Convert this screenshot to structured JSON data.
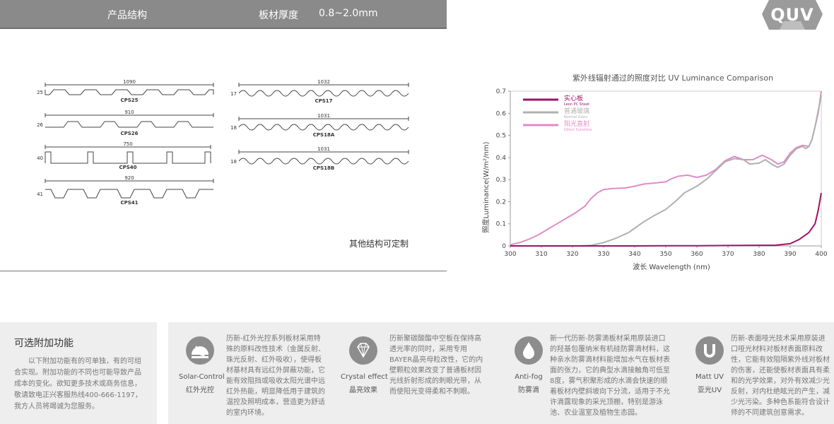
{
  "header": {
    "title": "产品结构",
    "thickness_label": "板材厚度",
    "thickness_value": "0.8~2.0mm"
  },
  "logo": {
    "text": "QUV"
  },
  "profiles": [
    {
      "name": "CPS25",
      "width": "1090",
      "height": "25"
    },
    {
      "name": "CPS26",
      "width": "910",
      "height": "26"
    },
    {
      "name": "CPS40",
      "width": "750",
      "height": "40"
    },
    {
      "name": "CPS41",
      "width": "920",
      "height": "41"
    },
    {
      "name": "CPS17",
      "width": "1032",
      "height": "17"
    },
    {
      "name": "CPS18A",
      "width": "1031",
      "height": "18"
    },
    {
      "name": "CPS18B",
      "width": "1031",
      "height": "18"
    }
  ],
  "custom_note": "其他结构可定制",
  "chart_data": {
    "type": "line",
    "title": "紫外线辐射通过的照度对比 UV Luminance Comparison",
    "xlabel": "波长 Wavelength (nm)",
    "ylabel": "照度Luminance(W/m²/nm)",
    "xlim": [
      300,
      400
    ],
    "ylim": [
      0,
      0.7
    ],
    "x_ticks": [
      "300",
      "310",
      "320",
      "330",
      "340",
      "350",
      "360",
      "370",
      "380",
      "390",
      "400"
    ],
    "y_ticks": [
      "0",
      "0.1",
      "0.2",
      "0.3",
      "0.4",
      "0.5",
      "0.6",
      "0.7"
    ],
    "legend_position": "top-left",
    "series": [
      {
        "name": "实心板",
        "name_en": "Leon PC Sheet",
        "color": "#a0106a",
        "points": [
          [
            300,
            0
          ],
          [
            340,
            0
          ],
          [
            350,
            0.001
          ],
          [
            360,
            0.001
          ],
          [
            370,
            0.002
          ],
          [
            380,
            0.003
          ],
          [
            385,
            0.003
          ],
          [
            390,
            0.01
          ],
          [
            393,
            0.03
          ],
          [
            396,
            0.06
          ],
          [
            398,
            0.1
          ],
          [
            399,
            0.16
          ],
          [
            400,
            0.24
          ]
        ]
      },
      {
        "name": "普通玻璃",
        "name_en": "Normal Glass",
        "color": "#b0b0b0",
        "points": [
          [
            300,
            0
          ],
          [
            322,
            0
          ],
          [
            326,
            0.003
          ],
          [
            330,
            0.015
          ],
          [
            334,
            0.035
          ],
          [
            338,
            0.06
          ],
          [
            340,
            0.08
          ],
          [
            343,
            0.11
          ],
          [
            346,
            0.135
          ],
          [
            350,
            0.165
          ],
          [
            353,
            0.2
          ],
          [
            356,
            0.24
          ],
          [
            360,
            0.27
          ],
          [
            363,
            0.3
          ],
          [
            366,
            0.34
          ],
          [
            369,
            0.38
          ],
          [
            372,
            0.395
          ],
          [
            375,
            0.39
          ],
          [
            377,
            0.37
          ],
          [
            380,
            0.375
          ],
          [
            382,
            0.39
          ],
          [
            384,
            0.37
          ],
          [
            386,
            0.355
          ],
          [
            388,
            0.37
          ],
          [
            390,
            0.41
          ],
          [
            392,
            0.44
          ],
          [
            394,
            0.45
          ],
          [
            395,
            0.44
          ],
          [
            396,
            0.45
          ],
          [
            397,
            0.48
          ],
          [
            398,
            0.54
          ],
          [
            399,
            0.61
          ],
          [
            400,
            0.68
          ]
        ]
      },
      {
        "name": "阳光直射",
        "name_en": "Direct Sunshine",
        "color": "#e08cc8",
        "points": [
          [
            300,
            0.005
          ],
          [
            303,
            0.015
          ],
          [
            306,
            0.03
          ],
          [
            309,
            0.05
          ],
          [
            312,
            0.075
          ],
          [
            315,
            0.1
          ],
          [
            318,
            0.125
          ],
          [
            321,
            0.15
          ],
          [
            324,
            0.18
          ],
          [
            326,
            0.215
          ],
          [
            328,
            0.24
          ],
          [
            330,
            0.255
          ],
          [
            333,
            0.26
          ],
          [
            337,
            0.262
          ],
          [
            340,
            0.27
          ],
          [
            343,
            0.28
          ],
          [
            347,
            0.285
          ],
          [
            350,
            0.29
          ],
          [
            352,
            0.305
          ],
          [
            354,
            0.315
          ],
          [
            357,
            0.32
          ],
          [
            360,
            0.31
          ],
          [
            363,
            0.32
          ],
          [
            366,
            0.345
          ],
          [
            369,
            0.385
          ],
          [
            372,
            0.405
          ],
          [
            375,
            0.39
          ],
          [
            378,
            0.39
          ],
          [
            381,
            0.41
          ],
          [
            384,
            0.39
          ],
          [
            386,
            0.37
          ],
          [
            388,
            0.38
          ],
          [
            390,
            0.42
          ],
          [
            392,
            0.445
          ],
          [
            394,
            0.455
          ],
          [
            396,
            0.45
          ],
          [
            397,
            0.48
          ],
          [
            398,
            0.54
          ],
          [
            399,
            0.6
          ],
          [
            400,
            0.7
          ]
        ]
      }
    ]
  },
  "options": {
    "title": "可选附加功能",
    "text": "以下附加功能有的可单独，有的可组合实现。附加功能的不同也可能导致产品成本的变化。欲知更多技术或商务信息，敬请致电正兴客服热线400-666-1197，我方人员将竭诚为您服务。"
  },
  "features": [
    {
      "icon": "solar-control-icon",
      "label_en": "Solar-Control",
      "label_cn": "红外光控",
      "text": "历新-红外光控系列板材采用特殊的原料改性技术（金属反射、珠光反射、红外吸收），使得板材基材具有远红外屏蔽功能，它能有效阻挡或吸收太阳光谱中远红外热能，明显降低用于建筑的温控及照明成本，营造更为舒适的室内环境。"
    },
    {
      "icon": "diamond-icon",
      "label_en": "Crystal effect",
      "label_cn": "晶亮效果",
      "text": "历新聚碳酸酯中空板在保持高透光率的同时，采用专用BAYER晶亮母粒改性，它的内壁颗粒效果改变了普通板材因光线折射形成的刺眼光带，从而使阳光变得柔和不刺眼。"
    },
    {
      "icon": "drop-icon",
      "label_en": "Anti-fog",
      "label_cn": "防雾滴",
      "text": "新一代历新-防雾滴板材采用原装进口的羟基包覆纳米有机硅防雾滴材料，这种亲水防雾滴材料能增加水气在板材表面的张力，它的典型水滴接触角可低至8度，雾气积聚形成的水滴会快速的顺着板材内壁斜坡向下分流，适用于不允许滴露现象的采光顶棚，特别是游泳池、农业温室及植物生态园。"
    },
    {
      "icon": "u-shape-icon",
      "label_en": "Matt UV",
      "label_cn": "亚光UV",
      "text": "历新-表面哑光技术采用原装进口哑光材料对板材表面原料改性，它能有效阻隔紫外线对板材的伤害，还能使板材表面具有柔和的光学效果，对外有效减少光反射，对内杜绝眩光的产生，减少光污染。多种色系能符合设计师的不同建筑创意需求。"
    }
  ]
}
